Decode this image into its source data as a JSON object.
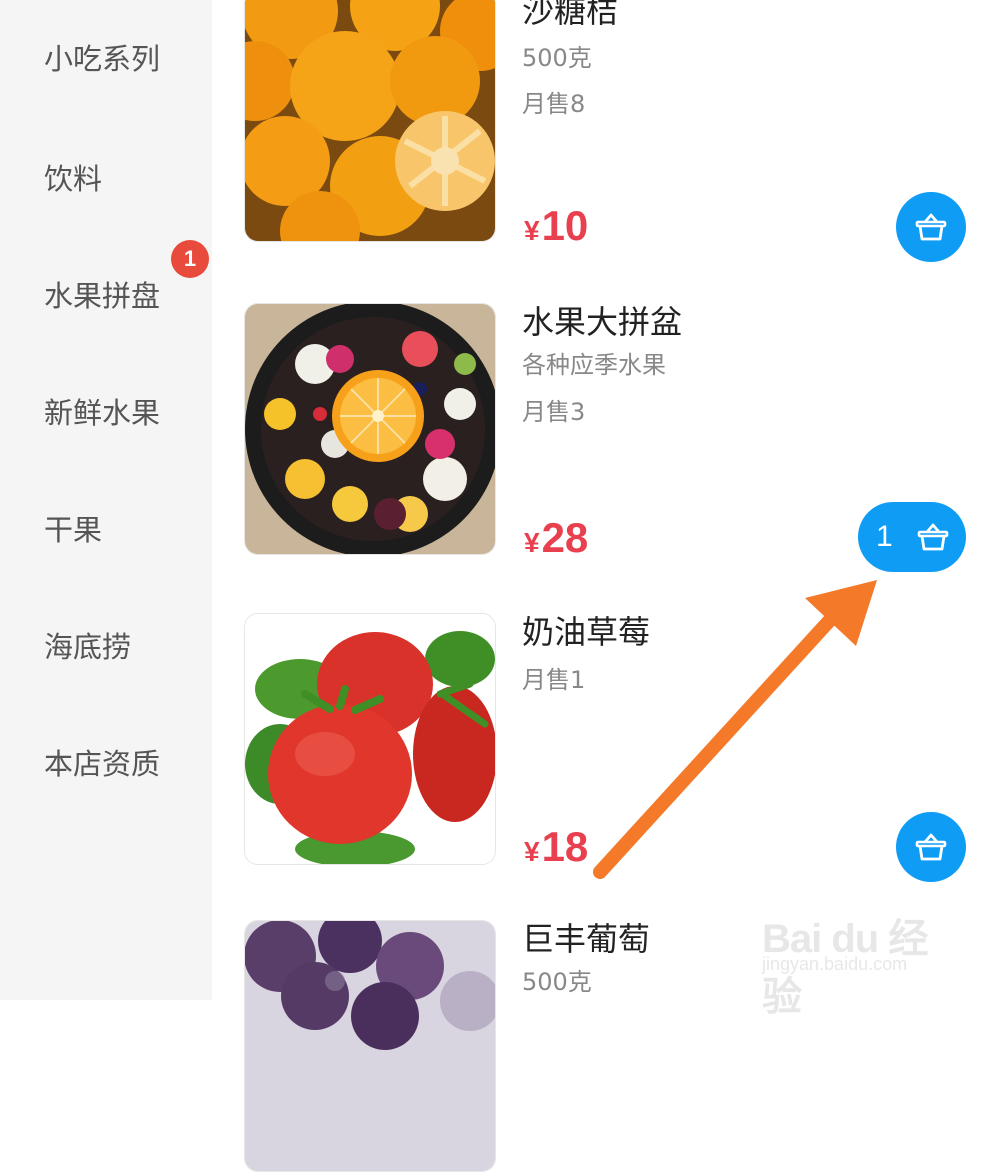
{
  "sidebar": {
    "items": [
      {
        "label": "小吃系列"
      },
      {
        "label": "饮料"
      },
      {
        "label": "水果拼盘",
        "badge": "1"
      },
      {
        "label": "新鲜水果"
      },
      {
        "label": "干果"
      },
      {
        "label": "海底捞"
      },
      {
        "label": "本店资质"
      }
    ]
  },
  "products": [
    {
      "name": "沙糖桔",
      "desc": "500克",
      "sold": "月售8",
      "currency": "¥",
      "price": "10",
      "image": "mandarin-oranges"
    },
    {
      "name": "水果大拼盆",
      "desc": "各种应季水果",
      "sold": "月售3",
      "currency": "¥",
      "price": "28",
      "image": "fruit-platter",
      "cart_count": "1"
    },
    {
      "name": "奶油草莓",
      "sold": "月售1",
      "currency": "¥",
      "price": "18",
      "image": "strawberries"
    },
    {
      "name": "巨丰葡萄",
      "desc": "500克",
      "image": "grapes"
    }
  ],
  "icons": {
    "cart": "basket-icon"
  },
  "colors": {
    "accent": "#0f9cf5",
    "price": "#e8404f",
    "badge": "#e84a3b",
    "arrow": "#f47a2a"
  },
  "watermark": {
    "logo": "Bai du 经验",
    "url": "jingyan.baidu.com"
  }
}
